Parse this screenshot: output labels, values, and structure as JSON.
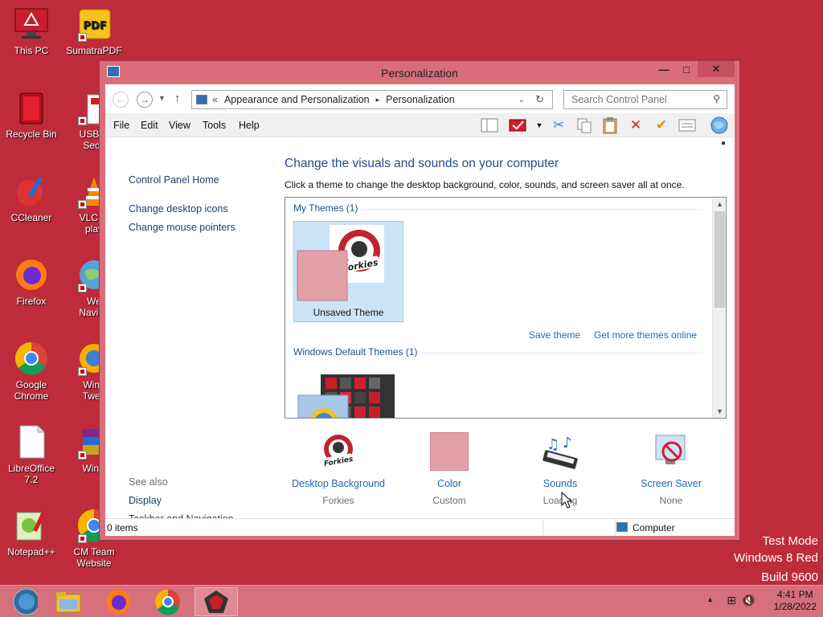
{
  "desktop": {
    "icons": [
      {
        "label": "This PC",
        "icon": "monitor-icon"
      },
      {
        "label": "SumatraPDF",
        "icon": "pdf-icon"
      },
      {
        "label": "Recycle Bin",
        "icon": "recycle-bin-icon"
      },
      {
        "label": "USB D\nSecu",
        "icon": "usb-icon"
      },
      {
        "label": "CCleaner",
        "icon": "ccleaner-icon"
      },
      {
        "label": "VLC m\nplay",
        "icon": "vlc-icon"
      },
      {
        "label": "Firefox",
        "icon": "firefox-icon"
      },
      {
        "label": "We\nNaviga",
        "icon": "globe-icon"
      },
      {
        "label": "Google\nChrome",
        "icon": "chrome-icon"
      },
      {
        "label": "Wina\nTwea",
        "icon": "winaero-icon"
      },
      {
        "label": "LibreOffice\n7.2",
        "icon": "document-icon"
      },
      {
        "label": "WinR",
        "icon": "winrar-icon"
      },
      {
        "label": "Notepad++",
        "icon": "notepad-icon"
      },
      {
        "label": "CM Team\nWebsite",
        "icon": "chrome-icon"
      }
    ],
    "watermark": {
      "line1": "Test Mode",
      "line2": "Windows 8 Red",
      "line3": "Build 9600"
    }
  },
  "window": {
    "title": "Personalization",
    "controls": {
      "minimize": "—",
      "maximize": "□",
      "close": "✕"
    },
    "address": {
      "prefix": "«",
      "crumb1": "Appearance and Personalization",
      "sep": "▸",
      "crumb2": "Personalization"
    },
    "search": {
      "placeholder": "Search Control Panel"
    },
    "menu": [
      "File",
      "Edit",
      "View",
      "Tools",
      "Help"
    ],
    "left_pane": {
      "home": "Control Panel Home",
      "links": [
        "Change desktop icons",
        "Change mouse pointers"
      ],
      "see_also_label": "See also",
      "see_also": [
        "Display",
        "Taskbar and Navigation"
      ]
    },
    "main": {
      "heading": "Change the visuals and sounds on your computer",
      "description": "Click a theme to change the desktop background, color, sounds, and screen saver all at once.",
      "my_themes_label": "My Themes (1)",
      "unsaved_theme": "Unsaved Theme",
      "save_theme": "Save theme",
      "get_more": "Get more themes online",
      "default_themes_label": "Windows Default Themes (1)",
      "logo_text": "Forkies"
    },
    "bottom": [
      {
        "label": "Desktop Background",
        "sub": "Forkies"
      },
      {
        "label": "Color",
        "sub": "Custom"
      },
      {
        "label": "Sounds",
        "sub": "Loading"
      },
      {
        "label": "Screen Saver",
        "sub": "None"
      }
    ],
    "status": {
      "items": "0 items",
      "location": "Computer"
    }
  },
  "taskbar": {
    "time": "4:41 PM",
    "date": "1/28/2022"
  },
  "colors": {
    "desktop": "#be2b3b",
    "accent": "#d96e7a",
    "link": "#1e6ab5"
  }
}
